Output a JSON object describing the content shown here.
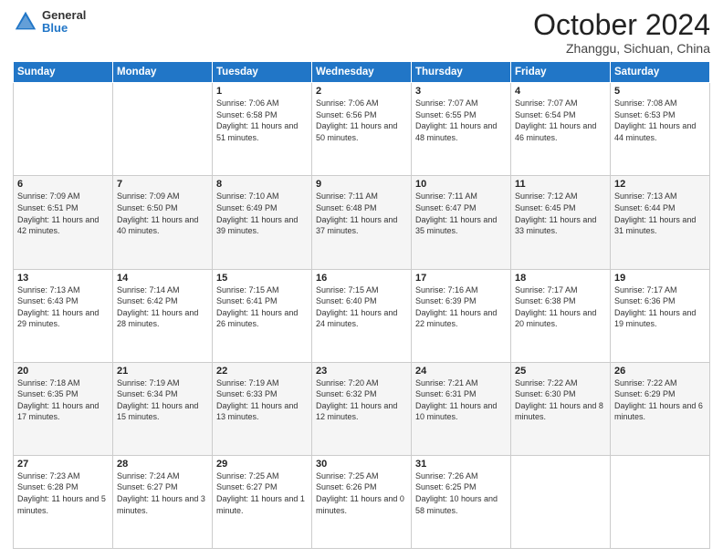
{
  "logo": {
    "general": "General",
    "blue": "Blue"
  },
  "header": {
    "month": "October 2024",
    "location": "Zhanggu, Sichuan, China"
  },
  "days_of_week": [
    "Sunday",
    "Monday",
    "Tuesday",
    "Wednesday",
    "Thursday",
    "Friday",
    "Saturday"
  ],
  "weeks": [
    [
      {
        "day": "",
        "info": ""
      },
      {
        "day": "",
        "info": ""
      },
      {
        "day": "1",
        "info": "Sunrise: 7:06 AM\nSunset: 6:58 PM\nDaylight: 11 hours and 51 minutes."
      },
      {
        "day": "2",
        "info": "Sunrise: 7:06 AM\nSunset: 6:56 PM\nDaylight: 11 hours and 50 minutes."
      },
      {
        "day": "3",
        "info": "Sunrise: 7:07 AM\nSunset: 6:55 PM\nDaylight: 11 hours and 48 minutes."
      },
      {
        "day": "4",
        "info": "Sunrise: 7:07 AM\nSunset: 6:54 PM\nDaylight: 11 hours and 46 minutes."
      },
      {
        "day": "5",
        "info": "Sunrise: 7:08 AM\nSunset: 6:53 PM\nDaylight: 11 hours and 44 minutes."
      }
    ],
    [
      {
        "day": "6",
        "info": "Sunrise: 7:09 AM\nSunset: 6:51 PM\nDaylight: 11 hours and 42 minutes."
      },
      {
        "day": "7",
        "info": "Sunrise: 7:09 AM\nSunset: 6:50 PM\nDaylight: 11 hours and 40 minutes."
      },
      {
        "day": "8",
        "info": "Sunrise: 7:10 AM\nSunset: 6:49 PM\nDaylight: 11 hours and 39 minutes."
      },
      {
        "day": "9",
        "info": "Sunrise: 7:11 AM\nSunset: 6:48 PM\nDaylight: 11 hours and 37 minutes."
      },
      {
        "day": "10",
        "info": "Sunrise: 7:11 AM\nSunset: 6:47 PM\nDaylight: 11 hours and 35 minutes."
      },
      {
        "day": "11",
        "info": "Sunrise: 7:12 AM\nSunset: 6:45 PM\nDaylight: 11 hours and 33 minutes."
      },
      {
        "day": "12",
        "info": "Sunrise: 7:13 AM\nSunset: 6:44 PM\nDaylight: 11 hours and 31 minutes."
      }
    ],
    [
      {
        "day": "13",
        "info": "Sunrise: 7:13 AM\nSunset: 6:43 PM\nDaylight: 11 hours and 29 minutes."
      },
      {
        "day": "14",
        "info": "Sunrise: 7:14 AM\nSunset: 6:42 PM\nDaylight: 11 hours and 28 minutes."
      },
      {
        "day": "15",
        "info": "Sunrise: 7:15 AM\nSunset: 6:41 PM\nDaylight: 11 hours and 26 minutes."
      },
      {
        "day": "16",
        "info": "Sunrise: 7:15 AM\nSunset: 6:40 PM\nDaylight: 11 hours and 24 minutes."
      },
      {
        "day": "17",
        "info": "Sunrise: 7:16 AM\nSunset: 6:39 PM\nDaylight: 11 hours and 22 minutes."
      },
      {
        "day": "18",
        "info": "Sunrise: 7:17 AM\nSunset: 6:38 PM\nDaylight: 11 hours and 20 minutes."
      },
      {
        "day": "19",
        "info": "Sunrise: 7:17 AM\nSunset: 6:36 PM\nDaylight: 11 hours and 19 minutes."
      }
    ],
    [
      {
        "day": "20",
        "info": "Sunrise: 7:18 AM\nSunset: 6:35 PM\nDaylight: 11 hours and 17 minutes."
      },
      {
        "day": "21",
        "info": "Sunrise: 7:19 AM\nSunset: 6:34 PM\nDaylight: 11 hours and 15 minutes."
      },
      {
        "day": "22",
        "info": "Sunrise: 7:19 AM\nSunset: 6:33 PM\nDaylight: 11 hours and 13 minutes."
      },
      {
        "day": "23",
        "info": "Sunrise: 7:20 AM\nSunset: 6:32 PM\nDaylight: 11 hours and 12 minutes."
      },
      {
        "day": "24",
        "info": "Sunrise: 7:21 AM\nSunset: 6:31 PM\nDaylight: 11 hours and 10 minutes."
      },
      {
        "day": "25",
        "info": "Sunrise: 7:22 AM\nSunset: 6:30 PM\nDaylight: 11 hours and 8 minutes."
      },
      {
        "day": "26",
        "info": "Sunrise: 7:22 AM\nSunset: 6:29 PM\nDaylight: 11 hours and 6 minutes."
      }
    ],
    [
      {
        "day": "27",
        "info": "Sunrise: 7:23 AM\nSunset: 6:28 PM\nDaylight: 11 hours and 5 minutes."
      },
      {
        "day": "28",
        "info": "Sunrise: 7:24 AM\nSunset: 6:27 PM\nDaylight: 11 hours and 3 minutes."
      },
      {
        "day": "29",
        "info": "Sunrise: 7:25 AM\nSunset: 6:27 PM\nDaylight: 11 hours and 1 minute."
      },
      {
        "day": "30",
        "info": "Sunrise: 7:25 AM\nSunset: 6:26 PM\nDaylight: 11 hours and 0 minutes."
      },
      {
        "day": "31",
        "info": "Sunrise: 7:26 AM\nSunset: 6:25 PM\nDaylight: 10 hours and 58 minutes."
      },
      {
        "day": "",
        "info": ""
      },
      {
        "day": "",
        "info": ""
      }
    ]
  ]
}
